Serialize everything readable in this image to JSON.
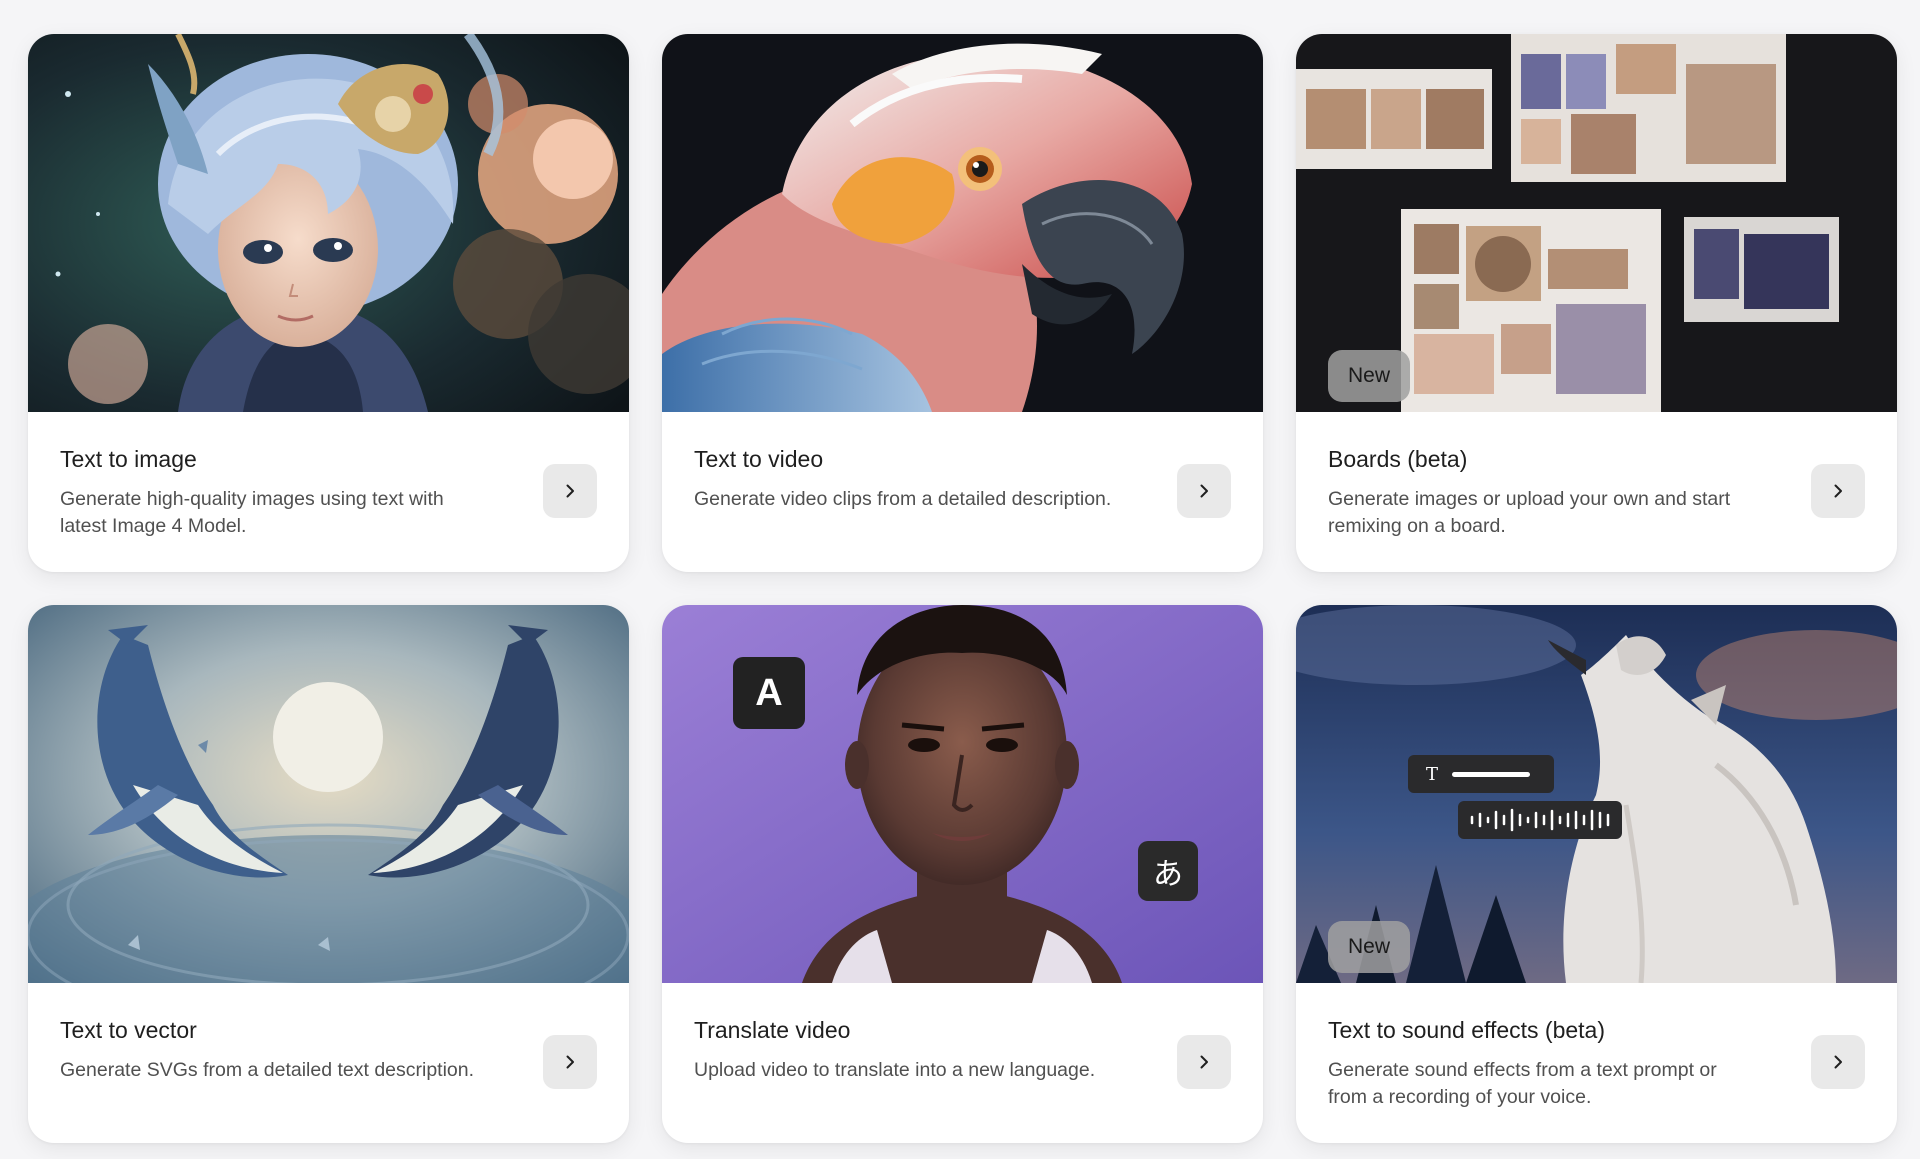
{
  "cards": [
    {
      "title": "Text to image",
      "description": "Generate high-quality images using text with latest Image 4 Model.",
      "image": "anime-child-portrait"
    },
    {
      "title": "Text to video",
      "description": "Generate video clips from a detailed description.",
      "image": "parrot-closeup"
    },
    {
      "title": "Boards (beta)",
      "description": "Generate images or upload your own and start remixing on a board.",
      "badge": "New",
      "image": "moodboard-collage"
    },
    {
      "title": "Text to vector",
      "description": "Generate SVGs from a detailed text description.",
      "image": "whales-vector"
    },
    {
      "title": "Translate video",
      "description": "Upload video to translate into a new language.",
      "image": "man-portrait-purple",
      "overlay": {
        "source_glyph": "A",
        "target_glyph": "あ"
      }
    },
    {
      "title": "Text to sound effects (beta)",
      "description": "Generate sound effects from a text prompt or from a recording of your voice.",
      "badge": "New",
      "image": "howling-wolf",
      "overlay": {
        "text_glyph": "T"
      }
    }
  ],
  "icons": {
    "next": "chevron-right-icon"
  },
  "colors": {
    "page_background": "#f5f5f7",
    "card_background": "#ffffff",
    "arrow_button": "#e9e9e9",
    "badge": "#a0a0a0"
  }
}
